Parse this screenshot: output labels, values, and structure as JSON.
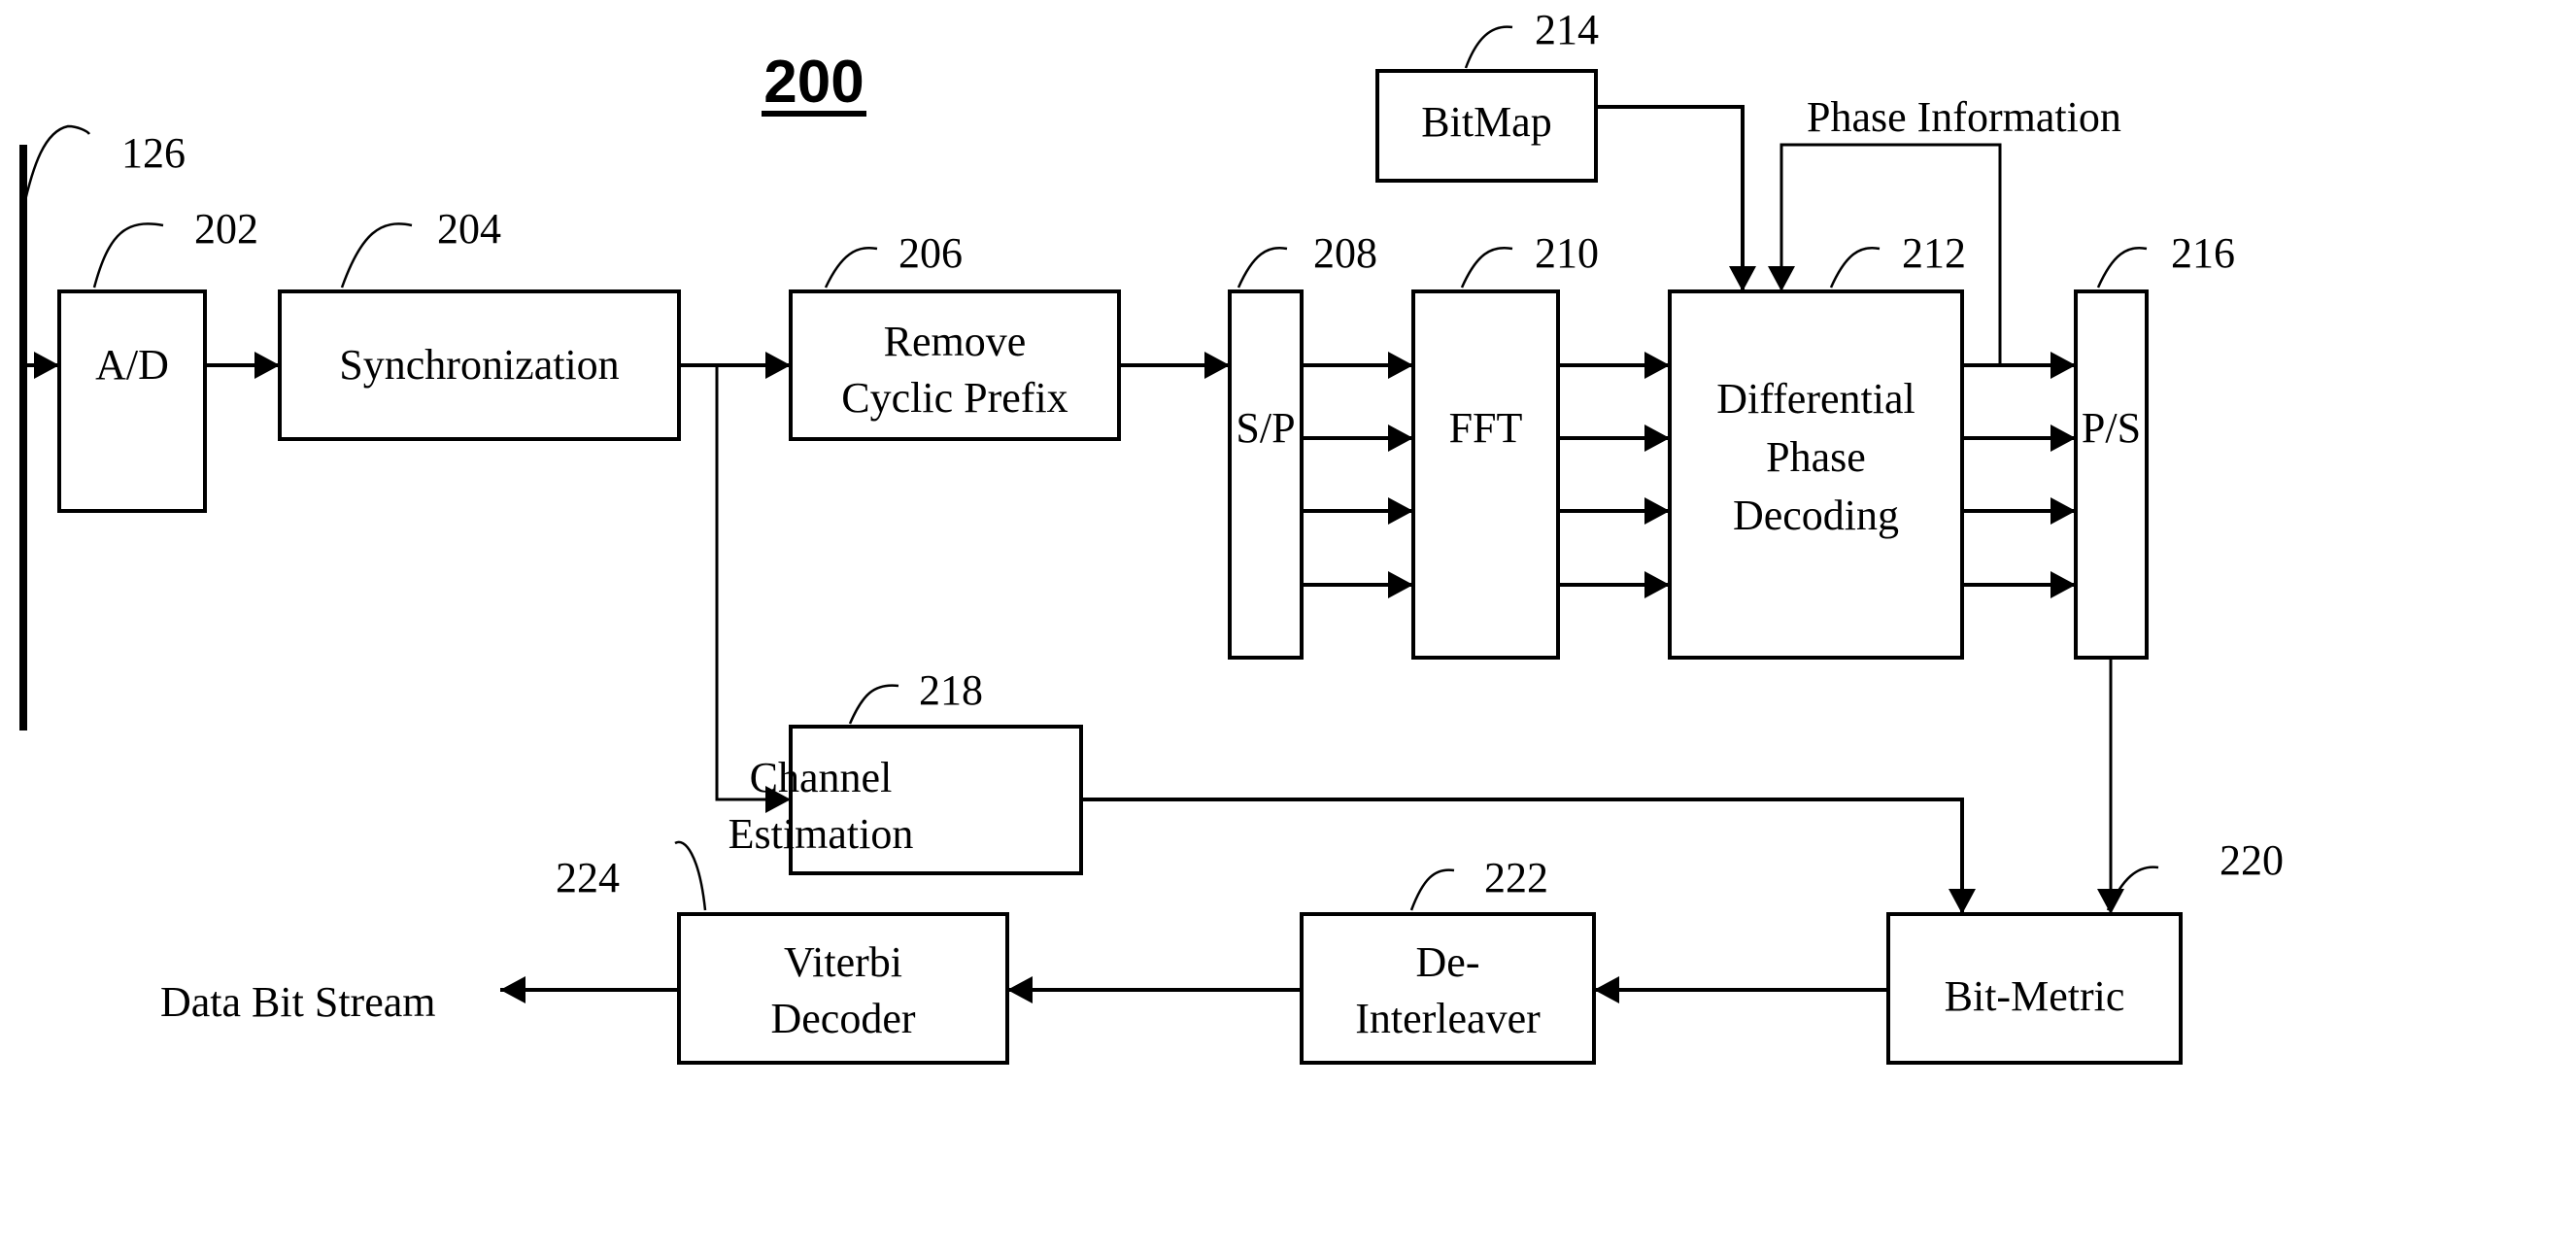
{
  "figure": {
    "title": "200",
    "antenna_ref": "126"
  },
  "blocks": {
    "ad": {
      "ref": "202",
      "lines": [
        "A/D"
      ]
    },
    "sync": {
      "ref": "204",
      "lines": [
        "Synchronization"
      ]
    },
    "rcp": {
      "ref": "206",
      "lines": [
        "Remove",
        "Cyclic Prefix"
      ]
    },
    "sp": {
      "ref": "208",
      "lines": [
        "S/P"
      ]
    },
    "fft": {
      "ref": "210",
      "lines": [
        "FFT"
      ]
    },
    "dpd": {
      "ref": "212",
      "lines": [
        "Differential",
        "Phase",
        "Decoding"
      ]
    },
    "bitmap": {
      "ref": "214",
      "lines": [
        "BitMap"
      ]
    },
    "ps": {
      "ref": "216",
      "lines": [
        "P/S"
      ]
    },
    "chest": {
      "ref": "218",
      "lines": [
        "Channel",
        "Estimation"
      ]
    },
    "bm": {
      "ref": "220",
      "lines": [
        "Bit-Metric"
      ]
    },
    "deint": {
      "ref": "222",
      "lines": [
        "De-",
        "Interleaver"
      ]
    },
    "vit": {
      "ref": "224",
      "lines": [
        "Viterbi",
        "Decoder"
      ]
    }
  },
  "annotations": {
    "phase_info": "Phase Information",
    "output": "Data Bit Stream"
  },
  "colors": {
    "ink": "#000000",
    "paper": "#ffffff"
  }
}
